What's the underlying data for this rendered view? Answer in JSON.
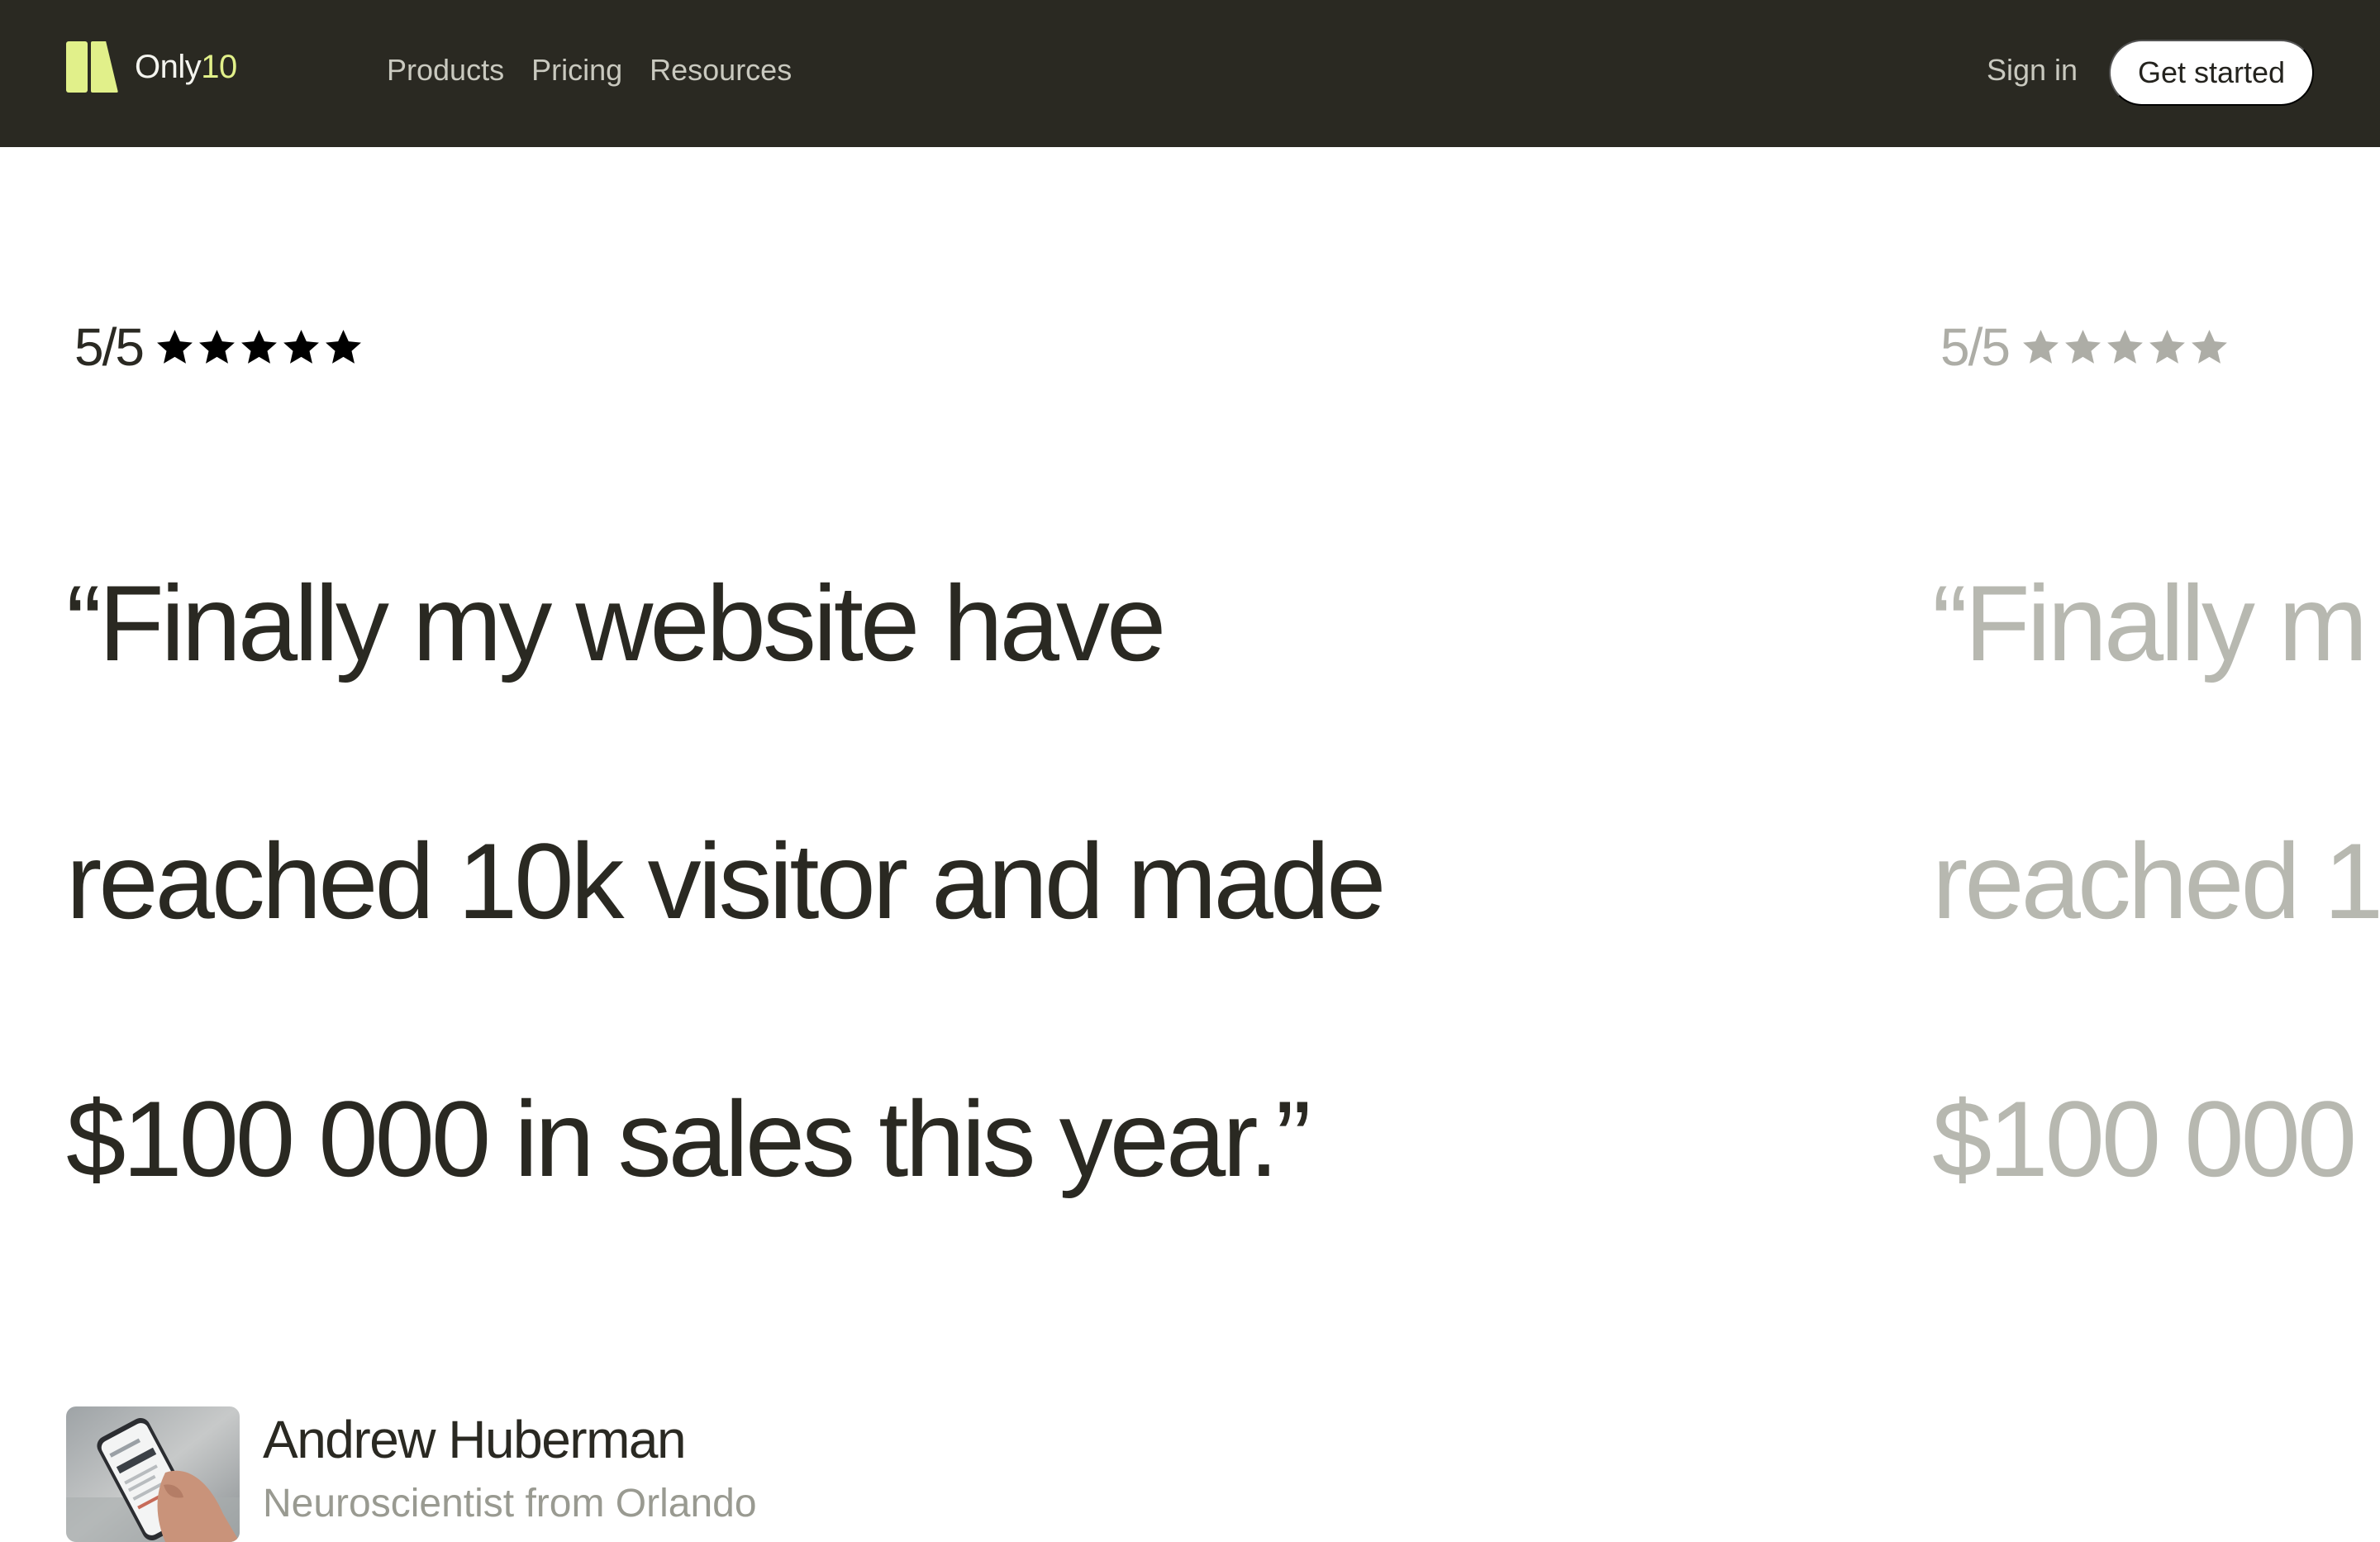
{
  "nav": {
    "brand_name": "Only",
    "brand_accent": "10",
    "links": [
      "Products",
      "Pricing",
      "Resources"
    ],
    "sign_in": "Sign in",
    "cta": "Get started"
  },
  "testimonials": [
    {
      "rating": "5/5",
      "stars": 5,
      "quote_line1": "“Finally my website have",
      "quote_line2": "reached 10k visitor and made",
      "quote_line3": "$100 000 in sales this year.”",
      "author_name": "Andrew Huberman",
      "author_role": "Neuroscientist from Orlando"
    },
    {
      "rating": "5/5",
      "stars": 5,
      "quote_line1": "“Finally m",
      "quote_line2": "reached 1",
      "quote_line3": "$100 000"
    }
  ],
  "colors": {
    "nav_background": "#2a2922",
    "brand_accent": "#e1f08a",
    "text_dark": "#2a2922",
    "text_muted": "#999a91",
    "faded_card": "#b7b8b0"
  },
  "icons": [
    "logo-mark-icon",
    "star-icon"
  ]
}
